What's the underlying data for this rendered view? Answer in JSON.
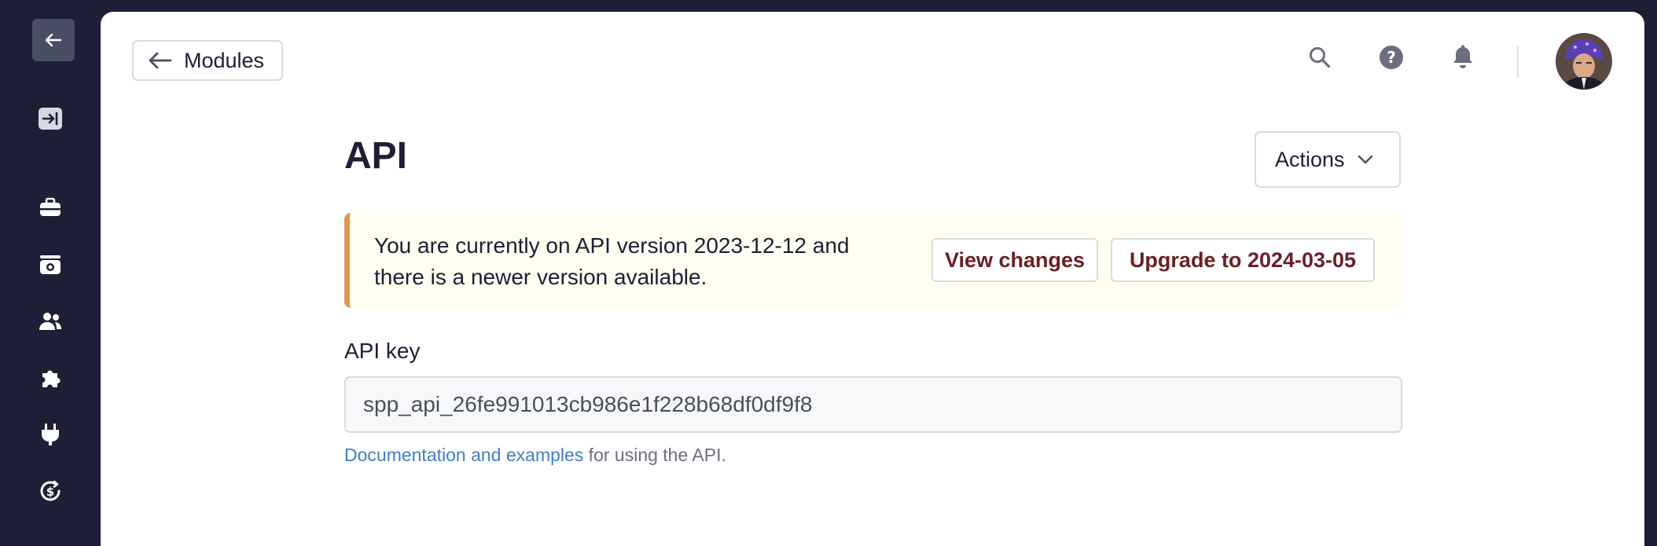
{
  "sidebar": {
    "icons": [
      "back-arrow-icon",
      "expand-sidebar-icon",
      "briefcase-icon",
      "camera-icon",
      "users-icon",
      "puzzle-icon",
      "plug-icon",
      "dollar-cycle-icon"
    ]
  },
  "header": {
    "back_label": "Modules",
    "icons": [
      "search-icon",
      "help-icon",
      "bell-icon"
    ]
  },
  "page": {
    "title": "API",
    "actions_label": "Actions"
  },
  "banner": {
    "message": "You are currently on API version 2023-12-12 and there is a newer version available.",
    "view_changes_label": "View changes",
    "upgrade_label": "Upgrade to 2024-03-05",
    "accent_color": "#e0984e",
    "background_color": "#fefef1"
  },
  "api_key": {
    "label": "API key",
    "value": "spp_api_26fe991013cb986e1f228b68df0df9f8",
    "help_link": "Documentation and examples",
    "help_suffix": " for using the API."
  },
  "colors": {
    "sidebar_bg": "#1c1f35",
    "link": "#3f7ed0",
    "button_text_dark_red": "#6b1f25"
  }
}
